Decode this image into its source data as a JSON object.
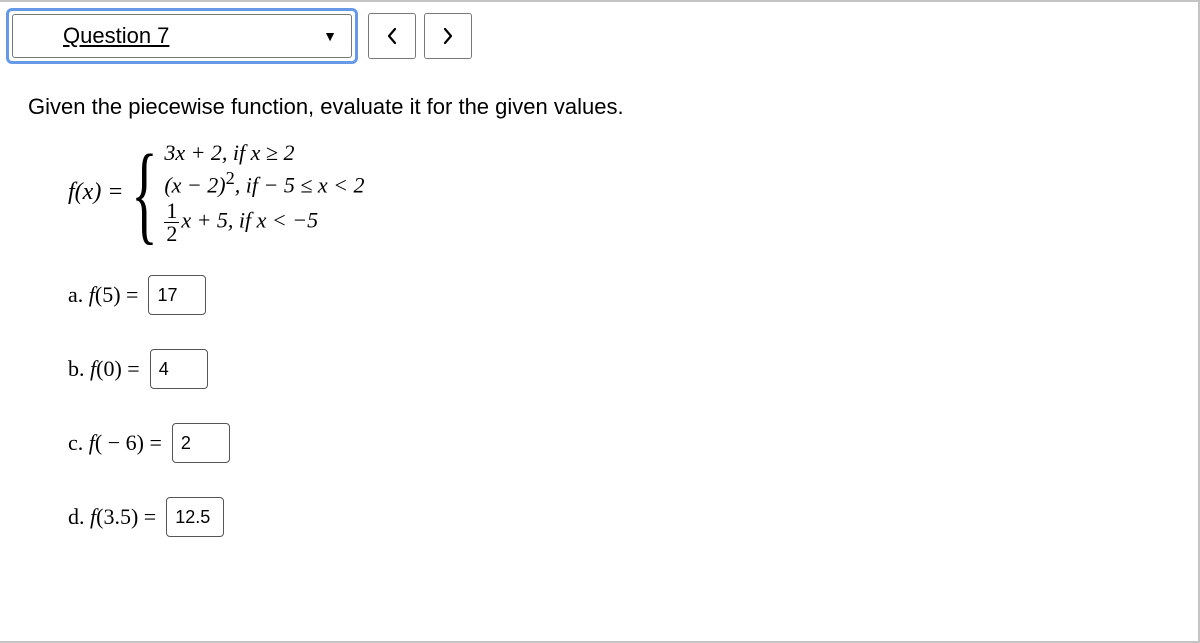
{
  "toolbar": {
    "question_label": "Question 7",
    "prev": "<",
    "next": ">"
  },
  "prompt": "Given the piecewise function, evaluate it for the given values.",
  "piecewise": {
    "lhs": "f(x) =",
    "pieces": {
      "p1": "3x + 2, if  x ≥ 2",
      "p2_a": "(x − 2)",
      "p2_sup": "2",
      "p2_b": ", if  − 5 ≤ x < 2",
      "p3_frac_num": "1",
      "p3_frac_den": "2",
      "p3_rest": "x + 5, if  x < −5"
    }
  },
  "answers": {
    "a": {
      "label_prefix": "a. ",
      "fn": "f",
      "arg": "(5)",
      "eq": " =",
      "value": "17"
    },
    "b": {
      "label_prefix": "b. ",
      "fn": "f",
      "arg": "(0)",
      "eq": " =",
      "value": "4"
    },
    "c": {
      "label_prefix": "c. ",
      "fn": "f",
      "arg": "( − 6)",
      "eq": " =",
      "value": "2"
    },
    "d": {
      "label_prefix": "d. ",
      "fn": "f",
      "arg": "(3.5)",
      "eq": " =",
      "value": "12.5"
    }
  }
}
